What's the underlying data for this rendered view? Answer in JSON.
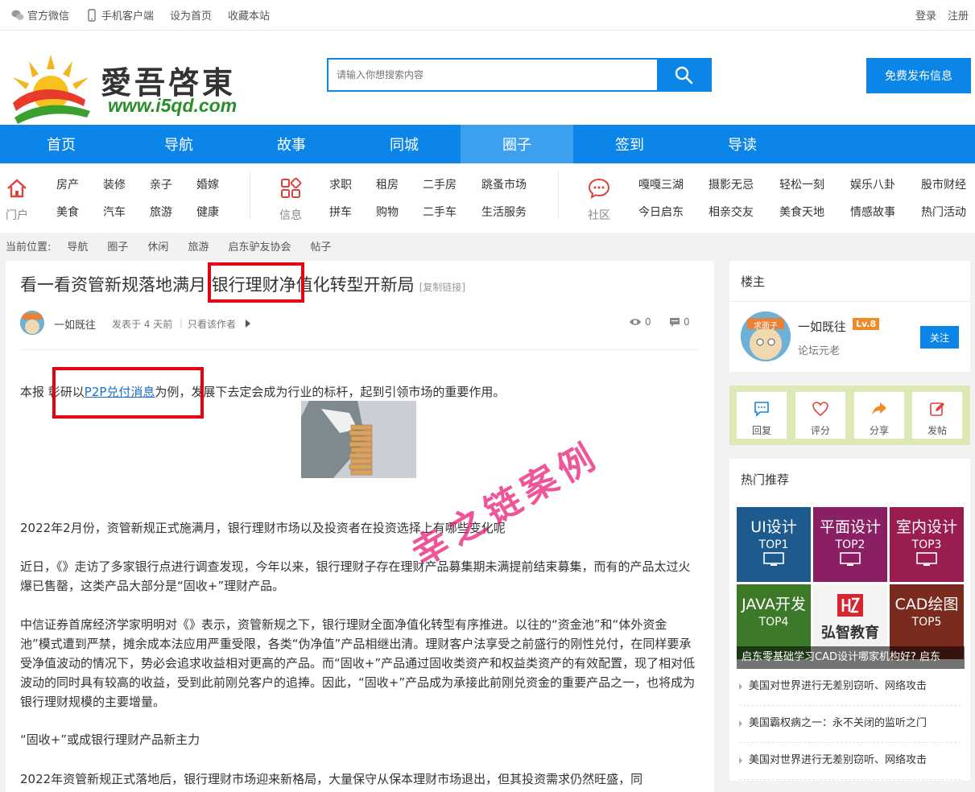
{
  "topbar": {
    "wechat": "官方微信",
    "mobile": "手机客户端",
    "set_home": "设为首页",
    "favorite": "收藏本站",
    "login": "登录",
    "register": "注册"
  },
  "header": {
    "brand": "愛吾啓東",
    "url": "www.i5qd.com",
    "search_placeholder": "请输入你想搜索内容",
    "publish": "免费发布信息"
  },
  "main_nav": [
    "首页",
    "导航",
    "故事",
    "同城",
    "圈子",
    "签到",
    "导读"
  ],
  "main_nav_active": "圈子",
  "category_nav": {
    "portal": {
      "label": "门户",
      "links": [
        "房产",
        "装修",
        "亲子",
        "婚嫁",
        "美食",
        "汽车",
        "旅游",
        "健康"
      ]
    },
    "info": {
      "label": "信息",
      "links": [
        "求职",
        "租房",
        "二手房",
        "跳蚤市场",
        "拼车",
        "购物",
        "二手车",
        "生活服务"
      ]
    },
    "community": {
      "label": "社区",
      "links": [
        "嘎嘎三湖",
        "摄影无忌",
        "轻松一刻",
        "娱乐八卦",
        "股市财经",
        "今日启东",
        "相亲交友",
        "美食天地",
        "情感故事",
        "热门活动"
      ]
    }
  },
  "breadcrumb": {
    "lead": "当前位置:",
    "items": [
      "导航",
      "圈子",
      "休闲",
      "旅游",
      "启东驴友协会",
      "帖子"
    ]
  },
  "article": {
    "title": "看一看资管新规落地满月 银行理财净值化转型开新局",
    "copy_link": "[复制链接]",
    "author": "一如既往",
    "posted": "发表于 4 天前",
    "only_author": "只看该作者",
    "views": "0",
    "comments": "0",
    "p1_before": "本报 彰研以",
    "p1_link": "P2P兑付消息",
    "p1_after": "为例，发展下去定会成为行业的标杆，起到引领市场的重要作用。",
    "p2": "2022年2月份，资管新规正式施满月，银行理财市场以及投资者在投资选择上有哪些变化呢",
    "p3": "近日，《》走访了多家银行点进行调查发现，今年以来，银行理财子存在理财产品募集期未满提前结束募集，而有的产品太过火爆已售罄，这类产品大部分是“固收+”理财产品。",
    "p4": "中信证券首席经济学家明明对《》表示，资管新规之下，银行理财全面净值化转型有序推进。以往的“资金池”和“体外资金池”模式遭到严禁，摊余成本法应用严重受限，各类“伪净值”产品相继出清。理财客户法享受之前盛行的刚性兑付，在同样要承受净值波动的情况下，势必会追求收益相对更高的产品。而“固收+”产品通过固收类资产和权益类资产的有效配置，现了相对低波动的同时具有较高的收益，受到此前刚兑客户的追捧。因此，“固收+”产品成为承接此前刚兑资金的重要产品之一，也将成为银行理财规模的主要增量。",
    "p5": "“固收+”或成银行理财产品新主力",
    "p6": "2022年资管新规正式落地后，银行理财市场迎来新格局，大量保守从保本理财市场退出，但其投资需求仍然旺盛，同",
    "watermark": "幸之链案例"
  },
  "sidebar": {
    "owner_title": "楼主",
    "owner_name": "一如既往",
    "owner_level": "Lv.8",
    "owner_rank": "论坛元老",
    "follow": "关注",
    "avatar_tag": "求面子",
    "actions": [
      "回复",
      "评分",
      "分享",
      "发帖"
    ],
    "hot_title": "热门推荐",
    "tiles": [
      {
        "name": "UI设计",
        "rank": "TOP1",
        "color": "#1d5b8f"
      },
      {
        "name": "平面设计",
        "rank": "TOP2",
        "color": "#8a1f64"
      },
      {
        "name": "室内设计",
        "rank": "TOP3",
        "color": "#9a1d52"
      },
      {
        "name": "JAVA开发",
        "rank": "TOP4",
        "color": "#3c7a2a"
      },
      {
        "name": "弘智教育",
        "rank": "",
        "color": "#f3f3f3"
      },
      {
        "name": "CAD绘图",
        "rank": "TOP5",
        "color": "#7b2b1e"
      }
    ],
    "banner": "启东零基础学习CAD设计哪家机构好? 启东",
    "hot_list": [
      "美国对世界进行无差别窃听、网络攻击",
      "美国霸权病之一：永不关闭的监听之门",
      "美国对世界进行无差别窃听、网络攻击"
    ]
  }
}
